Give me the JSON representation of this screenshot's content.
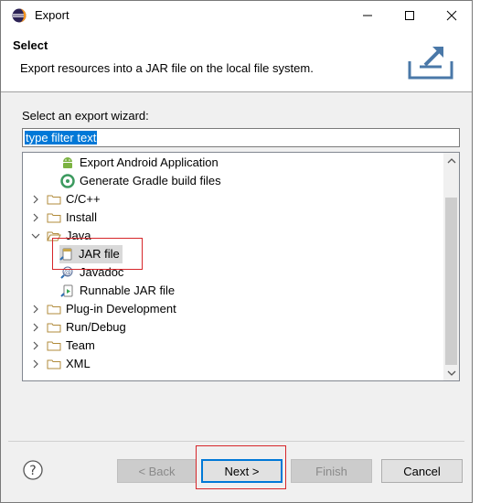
{
  "window": {
    "title": "Export",
    "icon": "eclipse-icon"
  },
  "banner": {
    "title": "Select",
    "description": "Export resources into a JAR file on the local file system."
  },
  "wizard": {
    "prompt": "Select an export wizard:",
    "filter_value": "type filter text",
    "tree": [
      {
        "label": "Export Android Application",
        "icon": "android-icon",
        "expanded": null,
        "level": 1
      },
      {
        "label": "Generate Gradle build files",
        "icon": "gradle-icon",
        "expanded": null,
        "level": 1
      },
      {
        "label": "C/C++",
        "icon": "folder-icon",
        "expanded": false,
        "level": 0
      },
      {
        "label": "Install",
        "icon": "folder-icon",
        "expanded": false,
        "level": 0
      },
      {
        "label": "Java",
        "icon": "folder-icon",
        "expanded": true,
        "level": 0
      },
      {
        "label": "JAR file",
        "icon": "jar-icon",
        "expanded": null,
        "level": 1,
        "selected": true
      },
      {
        "label": "Javadoc",
        "icon": "javadoc-icon",
        "expanded": null,
        "level": 1
      },
      {
        "label": "Runnable JAR file",
        "icon": "runnable-jar-icon",
        "expanded": null,
        "level": 1
      },
      {
        "label": "Plug-in Development",
        "icon": "folder-icon",
        "expanded": false,
        "level": 0
      },
      {
        "label": "Run/Debug",
        "icon": "folder-icon",
        "expanded": false,
        "level": 0
      },
      {
        "label": "Team",
        "icon": "folder-icon",
        "expanded": false,
        "level": 0
      },
      {
        "label": "XML",
        "icon": "folder-icon",
        "expanded": false,
        "level": 0
      }
    ]
  },
  "buttons": {
    "back": "< Back",
    "next": "Next >",
    "finish": "Finish",
    "cancel": "Cancel"
  },
  "colors": {
    "selection": "#0078d7",
    "annotation": "#d6262a"
  }
}
